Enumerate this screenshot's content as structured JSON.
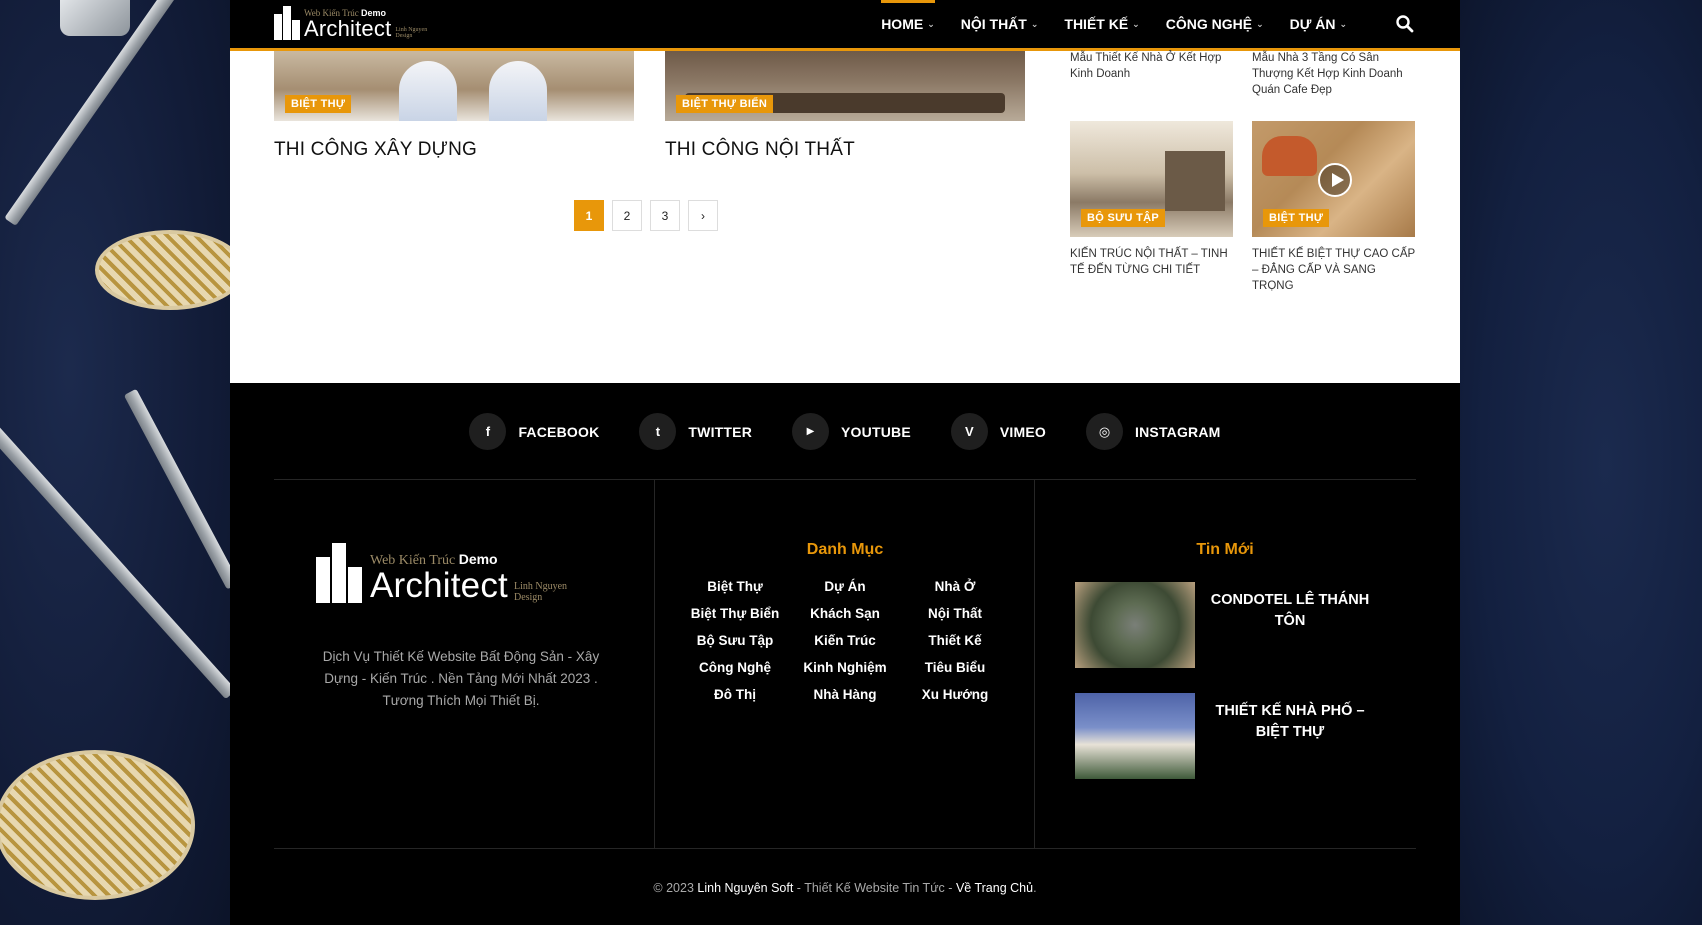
{
  "header": {
    "logo": {
      "small": "Web Kiến Trúc",
      "demo": "Demo",
      "big": "Architect",
      "sub1": "Linh Nguyen",
      "sub2": "Design"
    },
    "nav": [
      {
        "label": "HOME"
      },
      {
        "label": "NỘI THẤT"
      },
      {
        "label": "THIẾT KẾ"
      },
      {
        "label": "CÔNG NGHỆ"
      },
      {
        "label": "DỰ ÁN"
      }
    ]
  },
  "posts": [
    {
      "badge": "BIỆT THỰ",
      "title": "THI CÔNG XÂY DỰNG"
    },
    {
      "badge": "BIỆT THỰ BIỂN",
      "title": "THI CÔNG NỘI THẤT"
    }
  ],
  "pagination": {
    "pages": [
      "1",
      "2",
      "3"
    ],
    "next": "›"
  },
  "sidebar": {
    "top_titles": [
      "Mẫu Thiết Kế Nhà Ở Kết Hợp Kinh Doanh",
      "Mẫu Nhà 3 Tầng Có Sân Thượng Kết Hợp Kinh Doanh Quán Cafe Đẹp"
    ],
    "cards": [
      {
        "badge": "BỘ SƯU TẬP",
        "title": "KIẾN TRÚC NỘI THẤT – TINH TẾ ĐẾN TỪNG CHI TIẾT"
      },
      {
        "badge": "BIỆT THỰ",
        "title": "THIẾT KẾ BIỆT THỰ CAO CẤP – ĐẲNG CẤP VÀ SANG TRỌNG"
      }
    ]
  },
  "footer": {
    "social": [
      {
        "icon": "f",
        "label": "FACEBOOK"
      },
      {
        "icon": "t",
        "label": "TWITTER"
      },
      {
        "icon": "▶",
        "label": "YOUTUBE"
      },
      {
        "icon": "V",
        "label": "VIMEO"
      },
      {
        "icon": "◎",
        "label": "INSTAGRAM"
      }
    ],
    "description": "Dịch Vụ Thiết Kế Website Bất Động Sản - Xây Dựng - Kiến Trúc . Nền Tảng Mới Nhất 2023 . Tương Thích Mọi Thiết Bị.",
    "categories_title": "Danh Mục",
    "categories": [
      "Biệt Thự",
      "Dự Án",
      "Nhà Ở",
      "Biệt Thự Biển",
      "Khách Sạn",
      "Nội Thất",
      "Bộ Sưu Tập",
      "Kiến Trúc",
      "Thiết Kế",
      "Công Nghệ",
      "Kinh Nghiệm",
      "Tiêu Biểu",
      "Đô Thị",
      "Nhà Hàng",
      "Xu Hướng"
    ],
    "news_title": "Tin Mới",
    "news": [
      {
        "title": "CONDOTEL LÊ THÁNH TÔN"
      },
      {
        "title": "THIẾT KẾ NHÀ PHỐ – BIỆT THỰ"
      }
    ],
    "copyright": {
      "prefix": "© 2023",
      "brand": "Linh Nguyên Soft",
      "middle": "- Thiết Kế Website Tin Tức -",
      "home_link": "Về Trang Chủ",
      "suffix": "."
    }
  },
  "colors": {
    "accent": "#e8970a",
    "header_bg": "#000000",
    "footer_bg": "#000000"
  }
}
